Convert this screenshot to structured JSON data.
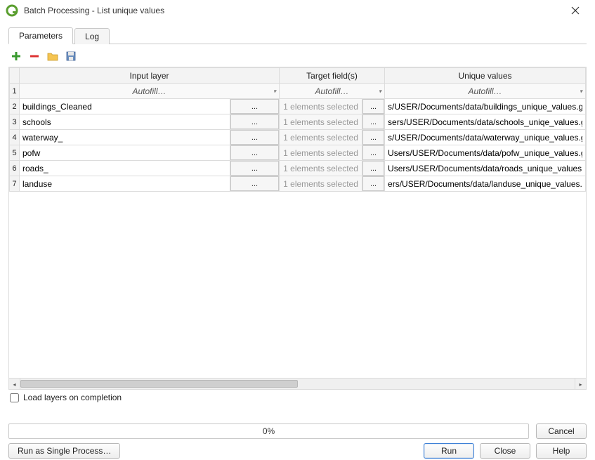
{
  "window": {
    "title": "Batch Processing - List unique values"
  },
  "tabs": {
    "parameters": "Parameters",
    "log": "Log"
  },
  "columns": {
    "input_layer": "Input layer",
    "target_fields": "Target field(s)",
    "unique_values": "Unique values",
    "autofill": "Autofill…"
  },
  "rows": [
    {
      "n": "1"
    },
    {
      "n": "2",
      "layer": "buildings_Cleaned",
      "target": "1 elements selected",
      "out": "s/USER/Documents/data/buildings_unique_values.gp"
    },
    {
      "n": "3",
      "layer": "schools",
      "target": "1 elements selected",
      "out": "sers/USER/Documents/data/schools_uniqe_values.gp"
    },
    {
      "n": "4",
      "layer": "waterway_",
      "target": "1 elements selected",
      "out": "s/USER/Documents/data/waterway_unique_values.gp"
    },
    {
      "n": "5",
      "layer": "pofw",
      "target": "1 elements selected",
      "out": "Users/USER/Documents/data/pofw_unique_values.gp"
    },
    {
      "n": "6",
      "layer": "roads_",
      "target": "1 elements selected",
      "out": "Users/USER/Documents/data/roads_unique_values.gp"
    },
    {
      "n": "7",
      "layer": "landuse",
      "target": "1 elements selected",
      "out": "ers/USER/Documents/data/landuse_unique_values.gp"
    }
  ],
  "ellipsis": "...",
  "load_layers_label": "Load layers on completion",
  "progress_text": "0%",
  "buttons": {
    "cancel": "Cancel",
    "run_single": "Run as Single Process…",
    "run": "Run",
    "close": "Close",
    "help": "Help"
  }
}
